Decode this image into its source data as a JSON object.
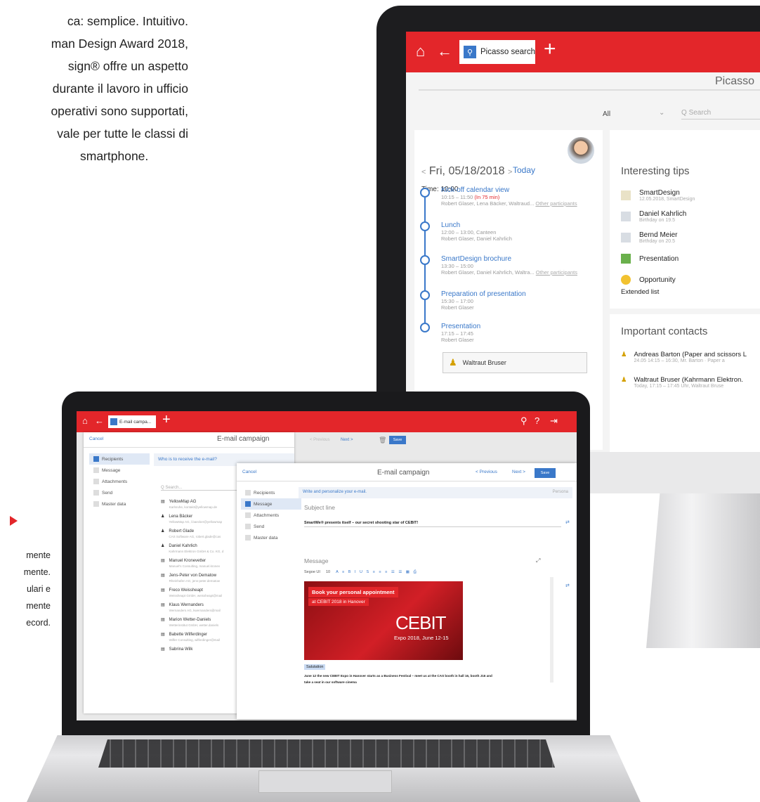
{
  "intro": {
    "lines": [
      "ca: semplice. Intuitivo.",
      "man Design Award 2018,",
      "sign® offre un aspetto",
      "durante il lavoro in ufficio",
      "operativi sono supportati,",
      "vale per tutte le classi di",
      "smartphone."
    ]
  },
  "side_note": {
    "lines": [
      "mente",
      "mente.",
      "ulari e",
      "mente",
      "ecord."
    ]
  },
  "monitor": {
    "tab_label": "Picasso search",
    "page_title": "Picasso",
    "filter_label": "All",
    "search_placeholder": "Search",
    "date": "Fri, 05/18/2018",
    "today_label": "Today",
    "time_label": "Time: 10:00",
    "events": [
      {
        "title": "Kick-off calendar view",
        "time": "10:15 – 11:50",
        "late": "(In 75 min)",
        "people": "Robert Glaser, Lena Bäcker, Waltraud...",
        "more": "Other participants"
      },
      {
        "title": "Lunch",
        "time": "12:00 – 13:00, Canteen",
        "late": "",
        "people": "Robert Glaser, Daniel Kahrlich",
        "more": ""
      },
      {
        "title": "SmartDesign brochure",
        "time": "13:30 – 15:00",
        "late": "",
        "people": "Robert Glaser, Daniel Kahrlich, Waltra...",
        "more": "Other participants"
      },
      {
        "title": "Preparation of presentation",
        "time": "15:30 – 17:00",
        "late": "",
        "people": "Robert Glaser",
        "more": ""
      },
      {
        "title": "Presentation",
        "time": "17:15 – 17:45",
        "late": "",
        "people": "Robert Glaser",
        "more": ""
      }
    ],
    "contact_chip": "Waltraut Bruser",
    "tips_title": "Interesting tips",
    "tips": [
      {
        "label": "SmartDesign",
        "sub": "12.05.2018, SmartDesign"
      },
      {
        "label": "Daniel Kahrlich",
        "sub": "Birthday on 19.5"
      },
      {
        "label": "Bernd Meier",
        "sub": "Birthday on 20.5"
      },
      {
        "label": "Presentation",
        "sub": ""
      },
      {
        "label": "Opportunity",
        "sub": ""
      }
    ],
    "extended_list": "Extended list",
    "contacts_title": "Important contacts",
    "contacts": [
      {
        "label": "Andreas Barton (Paper and scissors L",
        "sub": "24.05 14:15 – 16:30, Mr. Barton · Paper a"
      },
      {
        "label": "Waltraut Bruser (Kahrmann Elektron.",
        "sub": "Today, 17:15 – 17:45 Uhr, Waltraut Bruse"
      }
    ]
  },
  "laptop": {
    "tab_label": "E-mail campa...",
    "w1": {
      "cancel": "Cancel",
      "title": "E-mail campaign",
      "previous": "Previous",
      "next": "Next",
      "save": "Save",
      "question": "Who is to receive the e-mail?",
      "search_placeholder": "Search...",
      "steps": [
        "Recipients",
        "Message",
        "Attachments",
        "Send",
        "Master data"
      ],
      "contacts": [
        {
          "name": "YellowMap AG",
          "sub": "Karlsruhe, kontakt@yellowmap.de"
        },
        {
          "name": "Lena Bäcker",
          "sub": "YellowMap AG, l.baecker@yellowmap"
        },
        {
          "name": "Robert Glade",
          "sub": "CAS Software AG, robert.glade@cas"
        },
        {
          "name": "Daniel Kahrlich",
          "sub": "Kahrmann Elektron GmbH & Co. KG, d"
        },
        {
          "name": "Manuel Kronevetter",
          "sub": "Manuel's Consulting, manuel.kronev"
        },
        {
          "name": "Jens-Peter von Dematow",
          "sub": "Rheinhafen AG, jens-peter.dematow"
        },
        {
          "name": "Freco Weissheapt",
          "sub": "Weissheapt GmbH, weissheapt@mail"
        },
        {
          "name": "Klaus Wernanders",
          "sub": "Wernanders AG, kwernanders@mail"
        },
        {
          "name": "Marion Wetter-Daniels",
          "sub": "Wetterinstitut GmbH, wetter.daniels"
        },
        {
          "name": "Babette Wilferdinger",
          "sub": "Wilfer Consulting, wilferdinger@mail"
        },
        {
          "name": "Sabrina Wilk",
          "sub": ""
        }
      ]
    },
    "w2": {
      "cancel": "Cancel",
      "title": "E-mail campaign",
      "previous": "Previous",
      "next": "Next",
      "save": "Save",
      "steps": [
        "Recipients",
        "Message",
        "Attachments",
        "Send",
        "Master data"
      ],
      "hint": "Write and personalize your e-mail.",
      "hint_action": "Persona",
      "subject_label": "Subject line",
      "subject_value": "SmartWe® presents itself – our secret shooting star of CEBIT!",
      "message_label": "Message",
      "font": "Segoe UI",
      "font_size": "10",
      "banner_line1": "Book your personal appointment",
      "banner_line2": "at CEBIT 2018 in Hanover",
      "banner_brand": "CEBIT",
      "banner_sub": "Expo 2018, June 12-15",
      "salutation": "Salutation",
      "body_line1": "June 12 the new CEBIT Expo in Hanover starts as a Business Festival – meet us at the CAS booth in hall 16, booth J16 and",
      "body_line2": "take a seat in our software cinema"
    }
  },
  "colors": {
    "accent": "#e3262a",
    "blue": "#3a78c9"
  }
}
